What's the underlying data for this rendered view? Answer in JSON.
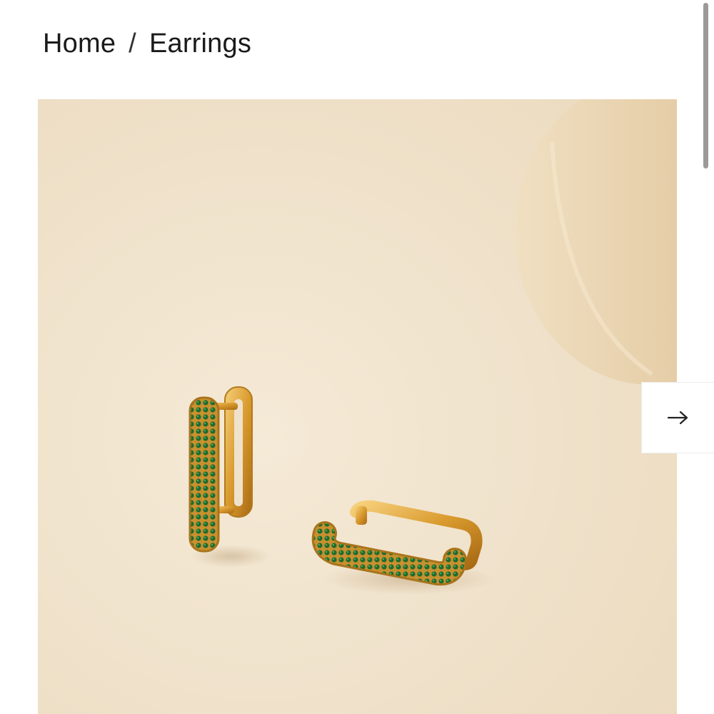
{
  "breadcrumb": {
    "home_label": "Home",
    "separator": "/",
    "current_label": "Earrings"
  },
  "gallery": {
    "next_icon": "arrow-right-icon",
    "next_glyph": "→"
  },
  "colors": {
    "background": "#ffffff",
    "product_backdrop": "#efe2cc",
    "vase": "#e8d4b2",
    "gold": "#d9a23c",
    "stones": "#1f6b2e",
    "text": "#1a1a1a"
  }
}
